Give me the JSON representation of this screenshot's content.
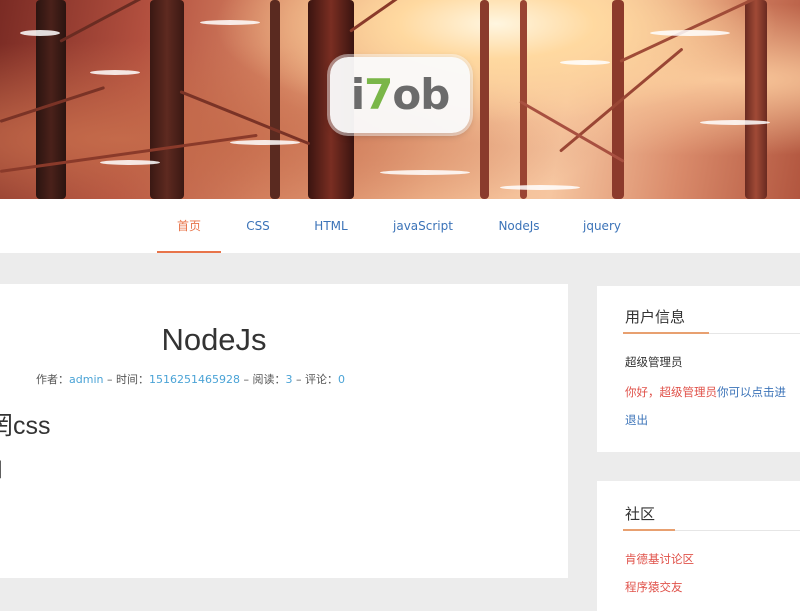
{
  "logo": {
    "part1": "i",
    "part2": "7",
    "part3": "ob"
  },
  "nav": {
    "items": [
      {
        "label": "首页"
      },
      {
        "label": "CSS"
      },
      {
        "label": "HTML"
      },
      {
        "label": "javaScript"
      },
      {
        "label": "NodeJs"
      },
      {
        "label": "jquery"
      }
    ]
  },
  "article": {
    "title": "NodeJs",
    "meta": {
      "author_label": "作者：",
      "author": "admin",
      "sep1": " – ",
      "time_label": "时间：",
      "time": "1516251465928",
      "sep2": " – ",
      "reads_label": "阅读：",
      "reads": "3",
      "sep3": " – ",
      "comments_label": "评论：",
      "comments": "0"
    },
    "body_fragment": "罔css",
    "body_line": "|"
  },
  "user_panel": {
    "title": "用户信息",
    "username": "超级管理员",
    "greeting": "你好，超级管理员",
    "greeting_suffix": "你可以点击进",
    "logout": "退出"
  },
  "community_panel": {
    "title": "社区",
    "links": [
      {
        "label": "肯德基讨论区"
      },
      {
        "label": "程序猿交友"
      }
    ]
  },
  "colors": {
    "accent": "#e8744a",
    "link": "#3b73b8",
    "meta_value": "#4aa3d6",
    "danger_text": "#e0524a"
  }
}
